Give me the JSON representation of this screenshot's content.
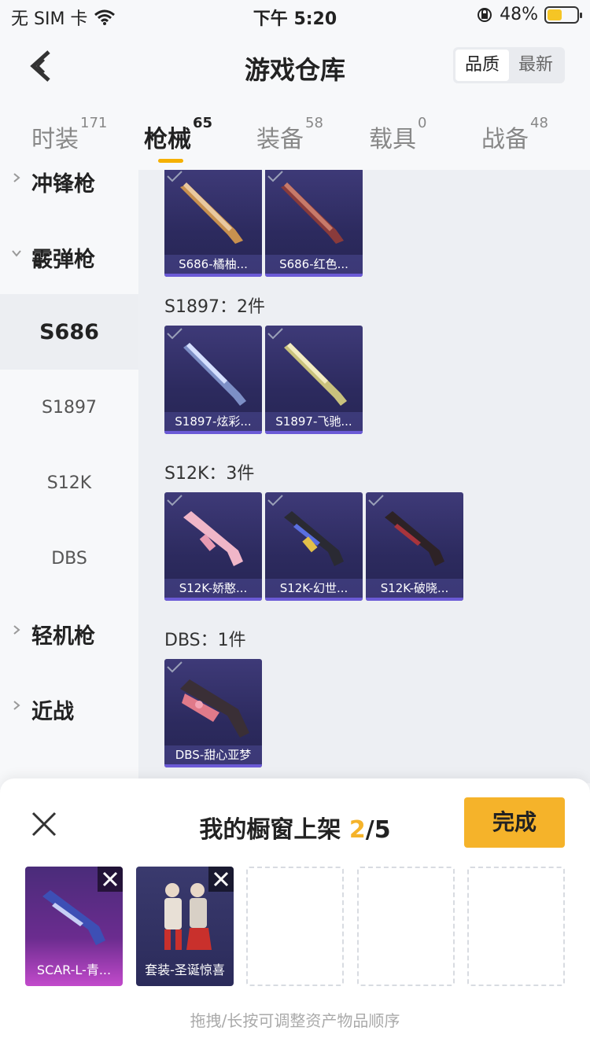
{
  "status": {
    "carrier": "无 SIM 卡",
    "time": "下午 5:20",
    "battery": "48%",
    "battery_level": 0.48
  },
  "header": {
    "title": "游戏仓库",
    "sort": [
      "品质",
      "最新"
    ]
  },
  "tabs": [
    {
      "label": "时装",
      "count": "171"
    },
    {
      "label": "枪械",
      "count": "65"
    },
    {
      "label": "装备",
      "count": "58"
    },
    {
      "label": "载具",
      "count": "0"
    },
    {
      "label": "战备",
      "count": "48"
    }
  ],
  "sidebar": {
    "items": [
      {
        "label": "冲锋枪"
      },
      {
        "label": "霰弹枪"
      },
      {
        "label": "S686"
      },
      {
        "label": "S1897"
      },
      {
        "label": "S12K"
      },
      {
        "label": "DBS"
      },
      {
        "label": "轻机枪"
      },
      {
        "label": "近战"
      }
    ]
  },
  "content": {
    "sections": [
      {
        "label": "",
        "items": [
          "S686-橘柚...",
          "S686-红色..."
        ]
      },
      {
        "label": "S1897：2件",
        "items": [
          "S1897-炫彩...",
          "S1897-飞驰..."
        ]
      },
      {
        "label": "S12K：3件",
        "items": [
          "S12K-娇憨...",
          "S12K-幻世...",
          "S12K-破晓..."
        ]
      },
      {
        "label": "DBS：1件",
        "items": [
          "DBS-甜心亚梦"
        ]
      }
    ]
  },
  "panel": {
    "title": "我的橱窗上架",
    "count": "2",
    "total": "/5",
    "done_label": "完成",
    "slots": [
      "SCAR-L-青...",
      "套装-圣诞惊喜"
    ],
    "hint": "拖拽/长按可调整资产物品顺序"
  },
  "colors": {
    "accent": "#f5b32a",
    "card_bg": "#2c2a5e",
    "active_side": "#eceef2"
  }
}
